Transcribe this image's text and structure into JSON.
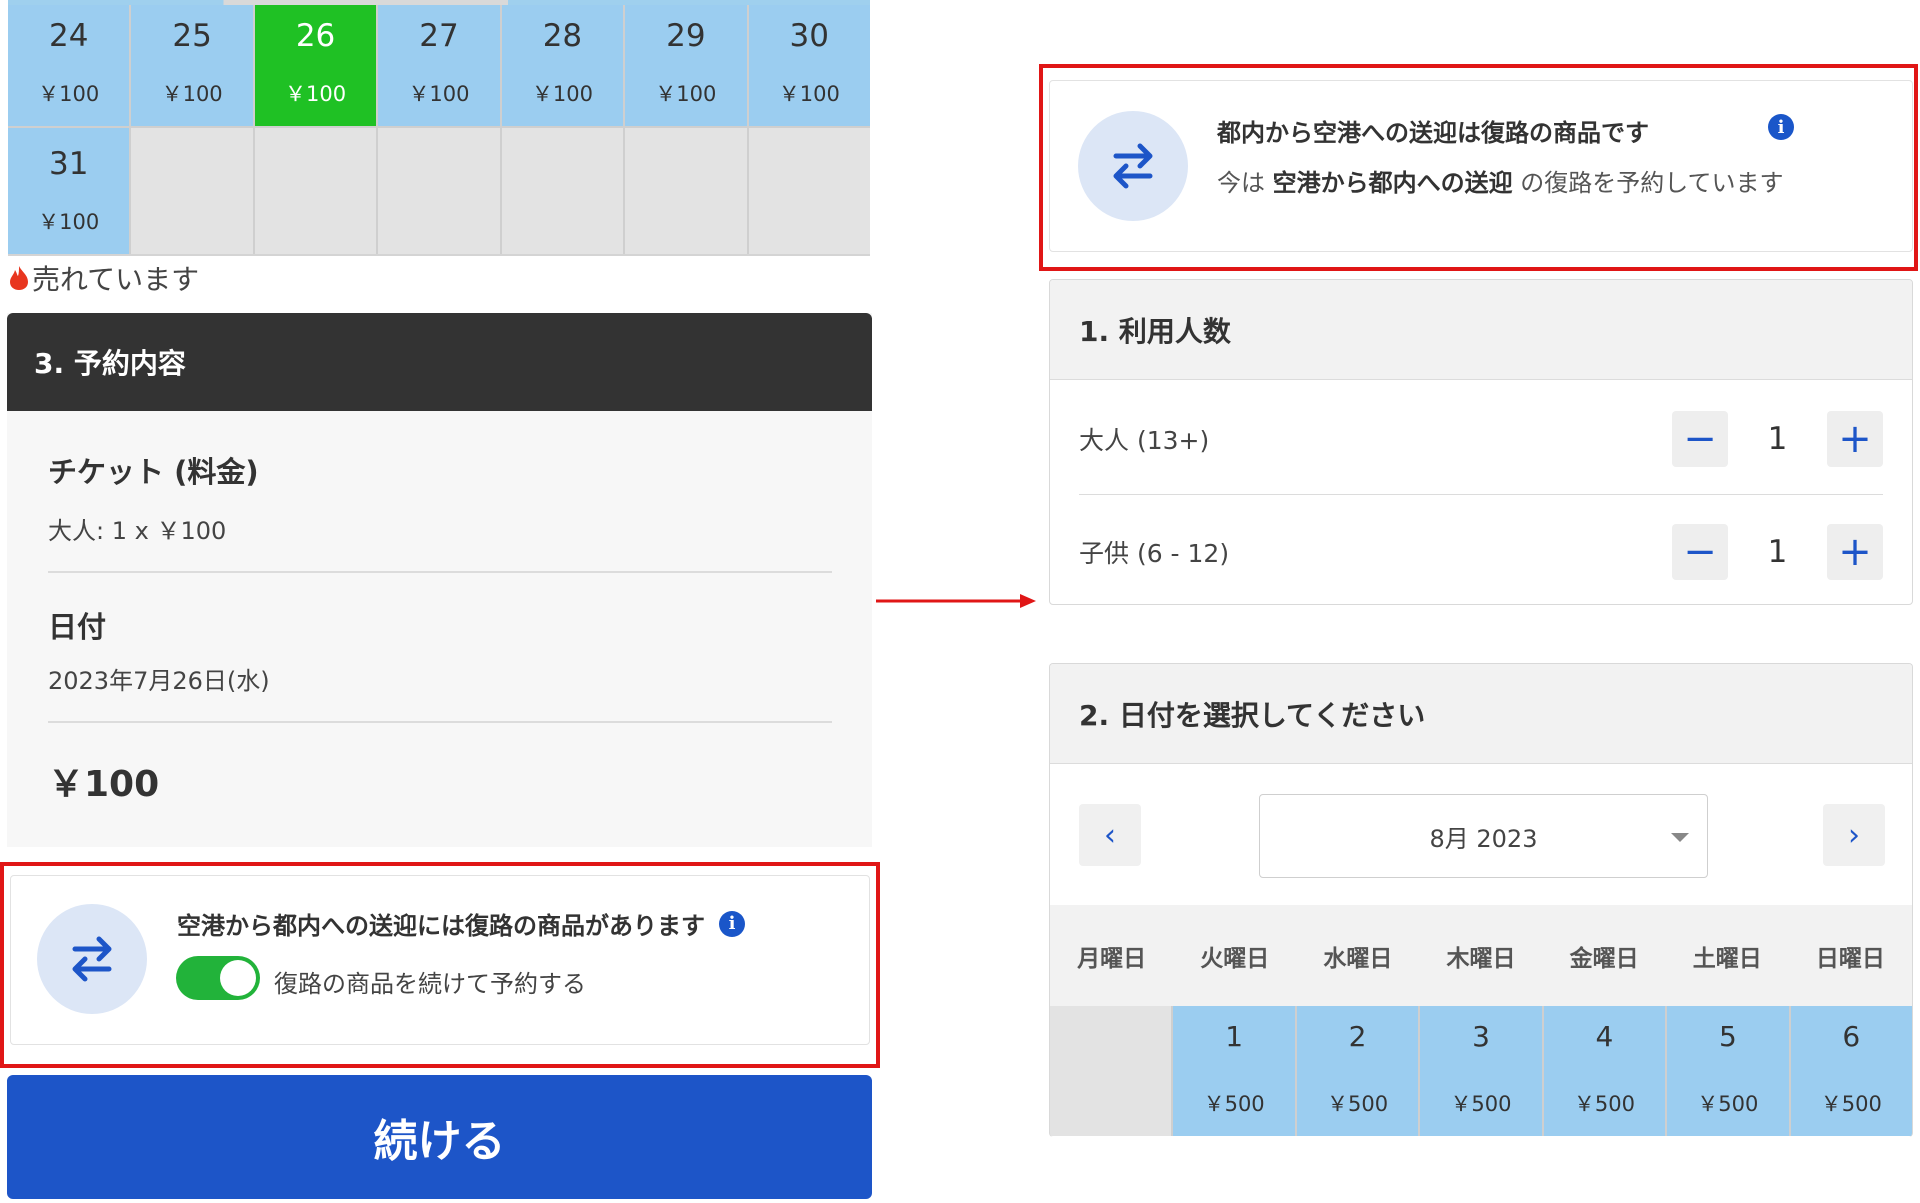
{
  "top_calendar": {
    "days": [
      {
        "day": "24",
        "price": "￥100",
        "state": "available"
      },
      {
        "day": "25",
        "price": "￥100",
        "state": "available"
      },
      {
        "day": "26",
        "price": "￥100",
        "state": "selected"
      },
      {
        "day": "27",
        "price": "￥100",
        "state": "available"
      },
      {
        "day": "28",
        "price": "￥100",
        "state": "available"
      },
      {
        "day": "29",
        "price": "￥100",
        "state": "available"
      },
      {
        "day": "30",
        "price": "￥100",
        "state": "available"
      },
      {
        "day": "31",
        "price": "￥100",
        "state": "available"
      }
    ],
    "sold_label": "売れています"
  },
  "summary": {
    "header": "3. 予約内容",
    "ticket_title": "チケット (料金)",
    "ticket_detail": "大人: 1 x ￥100",
    "date_title": "日付",
    "date_value": "2023年7月26日(水)",
    "total": "￥100"
  },
  "return_offer": {
    "title": "空港から都内への送迎には復路の商品があります",
    "toggle_label": "復路の商品を続けて予約する",
    "toggle_on": true
  },
  "continue_button": "続ける",
  "return_notice": {
    "title": "都内から空港への送迎は復路の商品です",
    "prefix": "今は",
    "highlight": "空港から都内への送迎",
    "suffix": "の復路を予約しています"
  },
  "people": {
    "header": "1. 利用人数",
    "rows": [
      {
        "label": "大人 (13+)",
        "value": "1"
      },
      {
        "label": "子供 (6 - 12)",
        "value": "1"
      }
    ],
    "minus": "−",
    "plus": "+"
  },
  "date_picker": {
    "header": "2. 日付を選択してください",
    "month": "8月 2023",
    "prev": "‹",
    "next": "›",
    "weekdays": [
      "月曜日",
      "火曜日",
      "水曜日",
      "木曜日",
      "金曜日",
      "土曜日",
      "日曜日"
    ],
    "days": [
      {
        "day": "",
        "price": "",
        "state": "empty"
      },
      {
        "day": "1",
        "price": "￥500",
        "state": "available"
      },
      {
        "day": "2",
        "price": "￥500",
        "state": "available"
      },
      {
        "day": "3",
        "price": "￥500",
        "state": "available"
      },
      {
        "day": "4",
        "price": "￥500",
        "state": "available"
      },
      {
        "day": "5",
        "price": "￥500",
        "state": "available"
      },
      {
        "day": "6",
        "price": "￥500",
        "state": "available"
      }
    ]
  },
  "colors": {
    "available": "#9bcdf0",
    "selected": "#1fc124",
    "primary": "#1d55c8",
    "highlight_border": "#e01616",
    "header_dark": "#333333"
  }
}
